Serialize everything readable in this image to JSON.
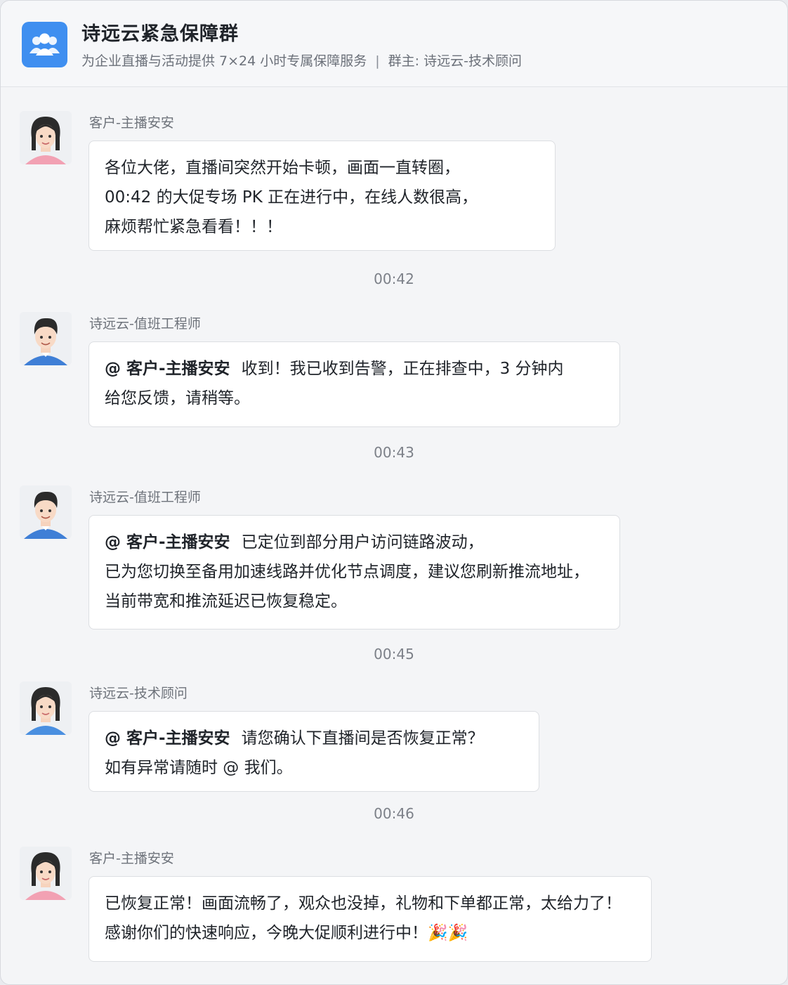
{
  "header": {
    "title": "诗远云紧急保障群",
    "subtitle": "为企业直播与活动提供 7×24 小时专属保障服务",
    "owner_label": "群主: 诗远云-技术顾问",
    "separator": "|",
    "avatar_icon": "group-people-icon"
  },
  "messages": [
    {
      "sender": "客户-主播安安",
      "avatar": "female-avatar-pink",
      "mention": "",
      "lines": [
        "各位大佬，直播间突然开始卡顿，画面一直转圈，",
        "00:42 的大促专场 PK 正在进行中，在线人数很高，",
        "麻烦帮忙紧急看看！！！"
      ]
    },
    {
      "sender": "诗远云-值班工程师",
      "avatar": "male-avatar-blue",
      "mention": "@ 客户-主播安安",
      "lines": [
        "收到！我已收到告警，正在排查中，3 分钟内",
        "给您反馈，请稍等。"
      ]
    },
    {
      "sender": "诗远云-值班工程师",
      "avatar": "male-avatar-blue",
      "mention": "@ 客户-主播安安",
      "lines": [
        "已定位到部分用户访问链路波动，",
        "已为您切换至备用加速线路并优化节点调度，建议您刷新推流地址，",
        "当前带宽和推流延迟已恢复稳定。"
      ]
    },
    {
      "sender": "诗远云-技术顾问",
      "avatar": "female-avatar-blue",
      "mention": "@ 客户-主播安安",
      "lines": [
        "请您确认下直播间是否恢复正常？",
        "如有异常请随时 @ 我们。"
      ]
    },
    {
      "sender": "客户-主播安安",
      "avatar": "female-avatar-pink",
      "mention": "",
      "lines": [
        "已恢复正常！画面流畅了，观众也没掉，礼物和下单都正常，太给力了！",
        "感谢你们的快速响应，今晚大促顺利进行中！🎉🎉"
      ]
    }
  ],
  "timestamps": [
    "00:42",
    "00:43",
    "00:45",
    "00:46"
  ],
  "colors": {
    "accent": "#3f8ff0",
    "background": "#f4f5f7",
    "bubble": "#ffffff",
    "text": "#1f2329",
    "muted": "#6e737b"
  }
}
